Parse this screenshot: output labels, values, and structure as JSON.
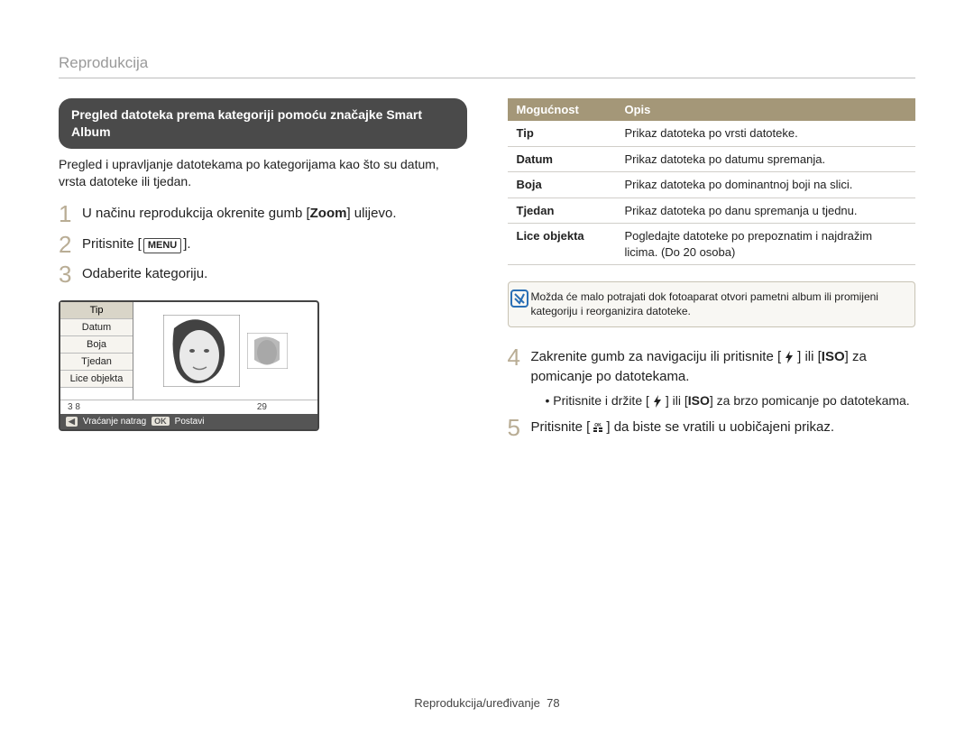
{
  "header": {
    "section_title": "Reprodukcija"
  },
  "left": {
    "pill_title": "Pregled datoteka prema kategoriji pomoću značajke Smart Album",
    "intro": "Pregled i upravljanje datotekama po kategorijama kao što su datum, vrsta datoteke ili tjedan.",
    "steps": {
      "s1_pre": "U načinu reprodukcija okrenite gumb [",
      "s1_bold": "Zoom",
      "s1_post": "] ulijevo.",
      "s2_pre": "Pritisnite [",
      "s2_btn": "MENU",
      "s2_post": "].",
      "s3": "Odaberite kategoriju."
    },
    "camera": {
      "menu": [
        "Tip",
        "Datum",
        "Boja",
        "Tjedan",
        "Lice objekta"
      ],
      "info_a": "3  8",
      "info_b": "29",
      "back_badge": "◀",
      "back_label": "Vraćanje natrag",
      "ok_badge": "OK",
      "ok_label": "Postavi"
    }
  },
  "right": {
    "table": {
      "head_opt": "Mogućnost",
      "head_desc": "Opis",
      "rows": [
        {
          "opt": "Tip",
          "desc": "Prikaz datoteka po vrsti datoteke."
        },
        {
          "opt": "Datum",
          "desc": "Prikaz datoteka po datumu spremanja."
        },
        {
          "opt": "Boja",
          "desc": "Prikaz datoteka po dominantnoj boji na slici."
        },
        {
          "opt": "Tjedan",
          "desc": "Prikaz datoteka po danu spremanja u tjednu."
        },
        {
          "opt": "Lice objekta",
          "desc": "Pogledajte datoteke po prepoznatim i najdražim licima. (Do 20 osoba)"
        }
      ]
    },
    "note": "Možda će malo potrajati dok fotoaparat otvori pametni album ili promijeni kategoriju i reorganizira datoteke.",
    "steps": {
      "s4_pre": "Zakrenite gumb za navigaciju ili pritisnite [",
      "s4_mid": "] ili [",
      "s4_iso": "ISO",
      "s4_post": "] za pomicanje po datotekama.",
      "s4_sub_pre": "Pritisnite i držite [",
      "s4_sub_mid": "] ili [",
      "s4_sub_post": "] za brzo pomicanje po datotekama.",
      "s5_pre": "Pritisnite [",
      "s5_icon": "OK",
      "s5_post": "] da biste se vratili u uobičajeni prikaz."
    }
  },
  "footer": {
    "text": "Reprodukcija/uređivanje",
    "page_num": "78"
  }
}
